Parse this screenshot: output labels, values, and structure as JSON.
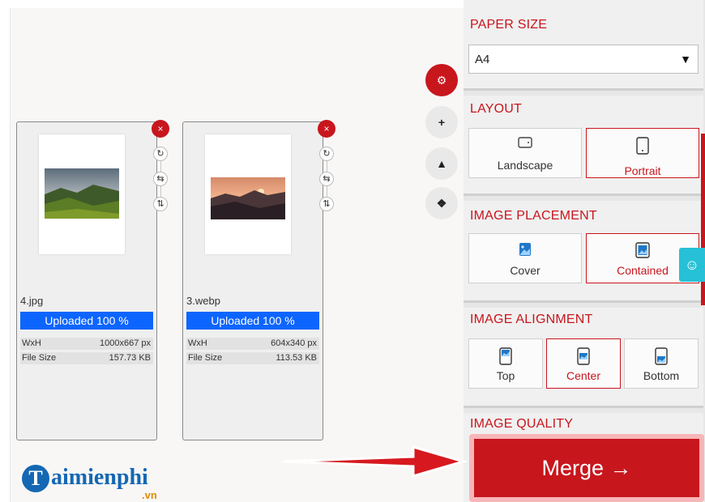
{
  "files": [
    {
      "name": "4.jpg",
      "progress_label": "Uploaded 100 %",
      "progress": 100,
      "rows": [
        {
          "key": "WxH",
          "value": "1000x667 px"
        },
        {
          "key": "File Size",
          "value": "157.73 KB"
        }
      ]
    },
    {
      "name": "3.webp",
      "progress_label": "Uploaded 100 %",
      "progress": 100,
      "rows": [
        {
          "key": "WxH",
          "value": "604x340 px"
        },
        {
          "key": "File Size",
          "value": "113.53 KB"
        }
      ]
    }
  ],
  "card_tools": {
    "remove": "×",
    "rotate": "↻",
    "swap_h": "⇆",
    "swap_v": "⇅"
  },
  "side_buttons": {
    "settings": "⚙",
    "add": "+",
    "drive": "▲",
    "dropbox": "❖"
  },
  "settings": {
    "paper_size": {
      "title": "PAPER SIZE",
      "value": "A4",
      "caret": "▼"
    },
    "layout": {
      "title": "LAYOUT",
      "options": [
        "Landscape",
        "Portrait"
      ],
      "selected": "Portrait"
    },
    "placement": {
      "title": "IMAGE PLACEMENT",
      "options": [
        "Cover",
        "Contained"
      ],
      "selected": "Contained"
    },
    "alignment": {
      "title": "IMAGE ALIGNMENT",
      "options": [
        "Top",
        "Center",
        "Bottom"
      ],
      "selected": "Center"
    },
    "quality": {
      "title": "IMAGE QUALITY"
    }
  },
  "merge_button": {
    "label": "Merge →"
  },
  "chat_widget": {
    "icon": "☺"
  },
  "logo": {
    "letter": "T",
    "text": "aimienphi",
    "sub": ".vn"
  },
  "colors": {
    "accent": "#c8161d",
    "progress": "#0d65ff",
    "logo_blue": "#1467b3",
    "chat": "#26c1d6"
  }
}
